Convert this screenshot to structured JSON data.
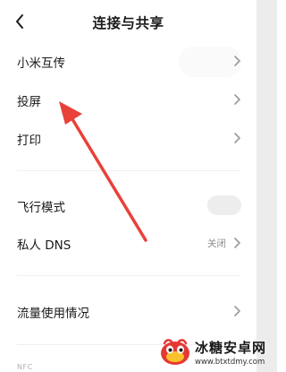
{
  "header": {
    "title": "连接与共享",
    "back_icon": "chevron-left-icon"
  },
  "rows": [
    {
      "label": "小米互传",
      "control": "chevron"
    },
    {
      "label": "投屏",
      "control": "chevron"
    },
    {
      "label": "打印",
      "control": "chevron"
    },
    {
      "label": "飞行模式",
      "control": "toggle",
      "toggle_on": false
    },
    {
      "label": "私人 DNS",
      "value": "关闭",
      "control": "chevron"
    },
    {
      "label": "流量使用情况",
      "control": "chevron"
    }
  ],
  "partial_section_label": "NFC",
  "annotation": {
    "type": "arrow",
    "color": "#e8413a"
  },
  "watermark": {
    "title": "冰糖安卓网",
    "url": "www.btxtdmy.com"
  },
  "colors": {
    "background": "#ffffff",
    "text": "#1a1a1a",
    "secondary_text": "#8a8a8a",
    "chevron": "#9a9a9a",
    "toggle_off": "#ededed",
    "arrow": "#e8413a"
  }
}
